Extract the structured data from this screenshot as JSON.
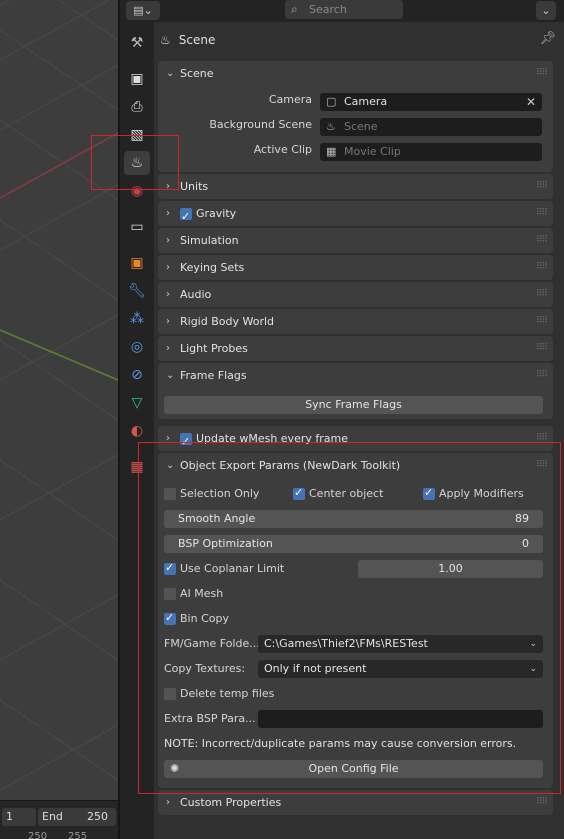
{
  "timeline": {
    "current_frame": "1",
    "end_label": "End",
    "end_value": "250",
    "row2_a": "250",
    "row2_b": "255"
  },
  "header": {
    "search_placeholder": "Search",
    "editor_type_icon": "properties-editor-icon"
  },
  "tabs": [
    {
      "name": "tool-icon"
    },
    {
      "name": "render-icon"
    },
    {
      "name": "output-icon"
    },
    {
      "name": "view-layer-icon"
    },
    {
      "name": "scene-icon",
      "active": true
    },
    {
      "name": "world-icon"
    },
    {
      "name": "collection-icon"
    },
    {
      "name": "object-icon"
    },
    {
      "name": "modifier-icon"
    },
    {
      "name": "particles-icon"
    },
    {
      "name": "physics-icon"
    },
    {
      "name": "constraints-icon"
    },
    {
      "name": "data-icon"
    },
    {
      "name": "material-icon"
    },
    {
      "name": "texture-icon"
    }
  ],
  "context": {
    "title": "Scene"
  },
  "scene_panel": {
    "title": "Scene",
    "camera_label": "Camera",
    "camera_value": "Camera",
    "background_label": "Background Scene",
    "background_placeholder": "Scene",
    "clip_label": "Active Clip",
    "clip_placeholder": "Movie Clip"
  },
  "collapsed_panels": [
    "Units",
    "Gravity",
    "Simulation",
    "Keying Sets",
    "Audio",
    "Rigid Body World",
    "Light Probes"
  ],
  "frame_flags": {
    "title": "Frame Flags",
    "button": "Sync Frame Flags"
  },
  "wmesh": {
    "title": "Update wMesh every frame"
  },
  "export": {
    "title": "Object Export Params (NewDark Toolkit)",
    "selection_only": "Selection Only",
    "center_object": "Center object",
    "apply_modifiers": "Apply Modifiers",
    "smooth_angle_label": "Smooth Angle",
    "smooth_angle_value": "89",
    "bsp_label": "BSP Optimization",
    "bsp_value": "0",
    "coplanar_label": "Use Coplanar Limit",
    "coplanar_value": "1.00",
    "ai_mesh": "AI Mesh",
    "bin_copy": "Bin Copy",
    "fm_label": "FM/Game Folde...",
    "fm_value": "C:\\Games\\Thief2\\FMs\\RESTest",
    "copy_label": "Copy Textures:",
    "copy_value": "Only if not present",
    "delete_temp": "Delete temp files",
    "extra_label": "Extra BSP Para...",
    "extra_value": "",
    "note": "NOTE: Incorrect/duplicate params may cause conversion errors.",
    "open_config": "Open Config File"
  },
  "custom_props": {
    "title": "Custom Properties"
  },
  "colors": {
    "accent": "#4772b3",
    "highlight_border": "#d0262a"
  }
}
